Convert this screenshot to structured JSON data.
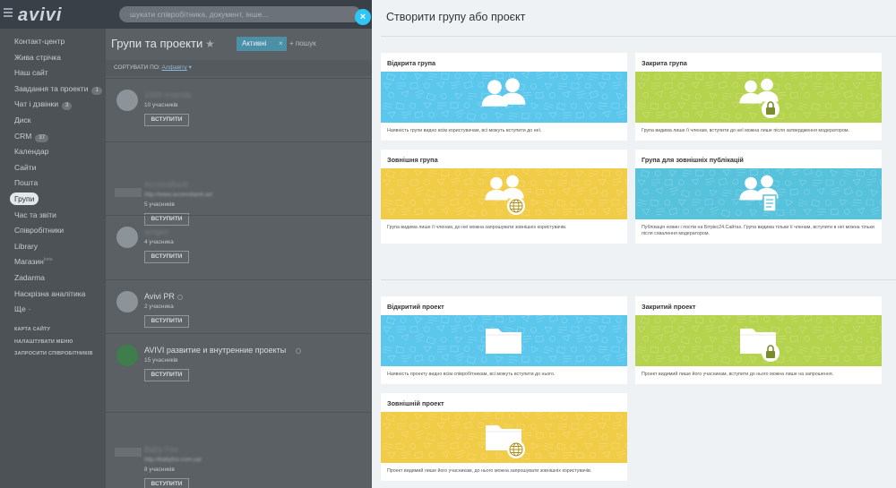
{
  "topbar": {
    "logo": "avivi",
    "search_placeholder": "шукати співробітника, документ, інше..."
  },
  "sidebar": {
    "items": [
      {
        "label": "Контакт-центр"
      },
      {
        "label": "Жива стрічка"
      },
      {
        "label": "Наш сайт"
      },
      {
        "label": "Завдання та проекти",
        "counter": "1"
      },
      {
        "label": "Чат і дзвінки",
        "counter": "3"
      },
      {
        "label": "Диск"
      },
      {
        "label": "CRM",
        "counter": "37"
      },
      {
        "label": "Календар"
      },
      {
        "label": "Сайти"
      },
      {
        "label": "Пошта"
      },
      {
        "label": "Групи",
        "active": true
      },
      {
        "label": "Час та звіти"
      },
      {
        "label": "Співробітники"
      },
      {
        "label": "Library"
      },
      {
        "label": "Магазин",
        "sup": "beta"
      },
      {
        "label": "Zadarma"
      },
      {
        "label": "Наскрізна аналітика"
      },
      {
        "label": "Ще",
        "arrow": "·"
      }
    ],
    "footer_links": [
      "КАРТА САЙТУ",
      "НАЛАШТУВАТИ МЕНЮ",
      "ЗАПРОСИТИ СПІВРОБІТНИКІВ"
    ]
  },
  "main": {
    "title": "Групи та проекти",
    "filter_label": "Активні",
    "filter_close": "×",
    "search_placeholder": "+ пошук",
    "sort_label": "СОРТУВАТИ ПО:",
    "sort_value": "Алфавіту",
    "groups": [
      {
        "name": "1000 платків",
        "subtitle": "",
        "count": "10 учасників",
        "button": "ВСТУПИТИ",
        "blurred": true
      },
      {
        "name": "AccessBank",
        "subtitle": "http://www.accessbank.az/",
        "count": "5 учасників",
        "button": "ВСТУПИТИ",
        "blurred": true
      },
      {
        "name": "amgen",
        "subtitle": "",
        "count": "4 учасника",
        "button": "ВСТУПИТИ",
        "blurred": true
      },
      {
        "name": "Avivi PR",
        "subtitle": "",
        "count": "2 учасника",
        "button": "ВСТУПИТИ",
        "blurred": false
      },
      {
        "name": "AVIVI развитие и внутренние проекты",
        "subtitle": "",
        "count": "15 учасників",
        "button": "ВСТУПИТИ",
        "blurred": false
      },
      {
        "name": "Baby Fox",
        "subtitle": "http://babyfox.com.ua/",
        "count": "8 учасників",
        "button": "ВСТУПИТИ",
        "blurred": true
      }
    ]
  },
  "close_button": "×",
  "panel": {
    "title": "Створити групу або проєкт",
    "cards": [
      {
        "title": "Відкрита група",
        "desc": "Наявність групи видно всім користувачам, всі можуть вступити до неї.",
        "color": "#5cc7ec",
        "icon": "group-icon"
      },
      {
        "title": "Закрита група",
        "desc": "Група видима лише її членам, вступити до неї можна лише після затвердження модератором.",
        "color": "#b6d34e",
        "icon": "group-lock-icon"
      },
      {
        "title": "Зовнішня група",
        "desc": "Група видима лише її членам, до неї можна запрошувати зовнішніх користувачів.",
        "color": "#f1cc47",
        "icon": "group-globe-icon"
      },
      {
        "title": "Група для зовнішніх публікацій",
        "desc": "Публікація новин і постів на Бітрікс24.Сайтах. Група видима тільки її членам, вступити в неї можна тільки після схвалення модератором.",
        "color": "#56c2dc",
        "icon": "group-document-icon"
      },
      {
        "title": "Відкритий проект",
        "desc": "Наявність проекту видно всім співробітникам, всі можуть вступити до нього.",
        "color": "#5cc7ec",
        "icon": "folder-icon"
      },
      {
        "title": "Закритий проект",
        "desc": "Проект видимий лише його учасникам, вступити до нього можна лише на запрошення.",
        "color": "#b6d34e",
        "icon": "folder-lock-icon"
      },
      {
        "title": "Зовнішній проект",
        "desc": "Проект видимий лише його учасникам, до нього можна запрошувати зовнішніх користувачів.",
        "color": "#f1cc47",
        "icon": "folder-globe-icon"
      }
    ]
  }
}
